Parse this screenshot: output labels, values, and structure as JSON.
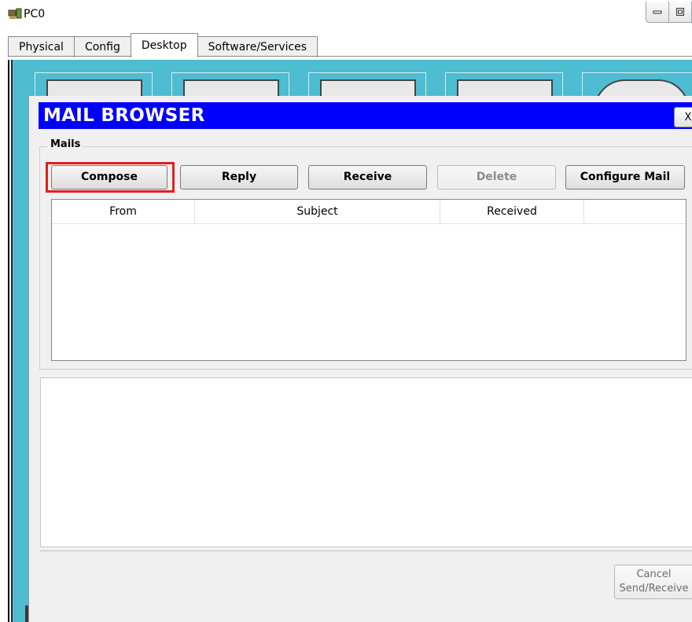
{
  "window": {
    "title": "PC0",
    "controls": [
      "minimize",
      "maximize"
    ]
  },
  "tabs": [
    {
      "label": "Physical",
      "active": false
    },
    {
      "label": "Config",
      "active": false
    },
    {
      "label": "Desktop",
      "active": true
    },
    {
      "label": "Software/Services",
      "active": false
    }
  ],
  "mail_browser": {
    "title": "MAIL BROWSER",
    "close_label": "X",
    "mails_group_label": "Mails",
    "buttons": {
      "compose": "Compose",
      "reply": "Reply",
      "receive": "Receive",
      "delete": "Delete",
      "configure": "Configure Mail"
    },
    "table": {
      "columns": [
        "From",
        "Subject",
        "Received",
        ""
      ],
      "rows": []
    },
    "cancel_line1": "Cancel",
    "cancel_line2": "Send/Receive"
  },
  "colors": {
    "mail_header": "#0000ff",
    "desktop_bg": "#4ebcd1",
    "highlight": "#e0201b"
  },
  "icons": [
    "pc-icon",
    "minimize-icon",
    "maximize-icon",
    "close-icon"
  ]
}
